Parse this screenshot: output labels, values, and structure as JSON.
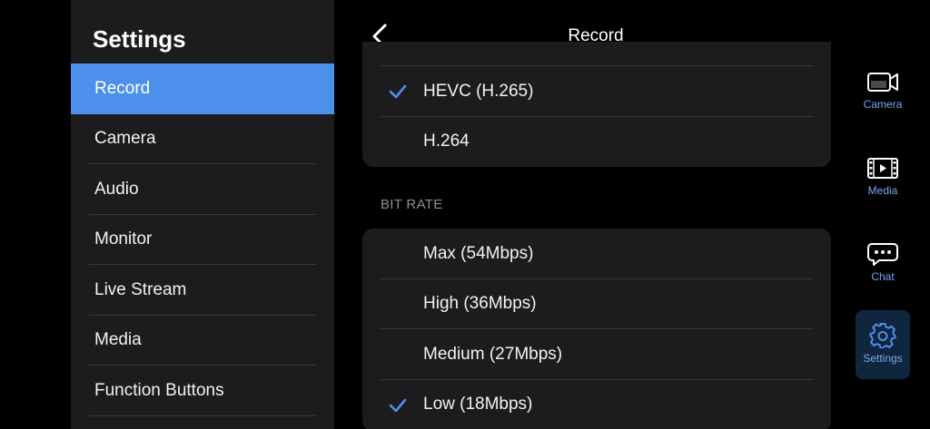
{
  "settings": {
    "title": "Settings",
    "items": [
      {
        "label": "Record",
        "active": true
      },
      {
        "label": "Camera"
      },
      {
        "label": "Audio"
      },
      {
        "label": "Monitor"
      },
      {
        "label": "Live Stream"
      },
      {
        "label": "Media"
      },
      {
        "label": "Function Buttons"
      }
    ]
  },
  "header": {
    "title": "Record",
    "back_icon": "chevron-left-icon"
  },
  "codec": {
    "options": [
      {
        "label": "HEVC (H.265)",
        "selected": true
      },
      {
        "label": "H.264",
        "selected": false
      }
    ]
  },
  "bitrate": {
    "section_label": "BIT RATE",
    "options": [
      {
        "label": "Max (54Mbps)",
        "selected": false
      },
      {
        "label": "High (36Mbps)",
        "selected": false
      },
      {
        "label": "Medium (27Mbps)",
        "selected": false
      },
      {
        "label": "Low (18Mbps)",
        "selected": true
      }
    ]
  },
  "nav": {
    "items": [
      {
        "label": "Camera",
        "icon": "camera-icon"
      },
      {
        "label": "Media",
        "icon": "film-icon"
      },
      {
        "label": "Chat",
        "icon": "chat-icon"
      },
      {
        "label": "Settings",
        "icon": "gear-icon",
        "active": true
      }
    ]
  },
  "colors": {
    "accent": "#4d90ec",
    "panel": "#1c1c1e",
    "nav_label": "#7aa7f0",
    "section_label": "#8e8e93"
  }
}
